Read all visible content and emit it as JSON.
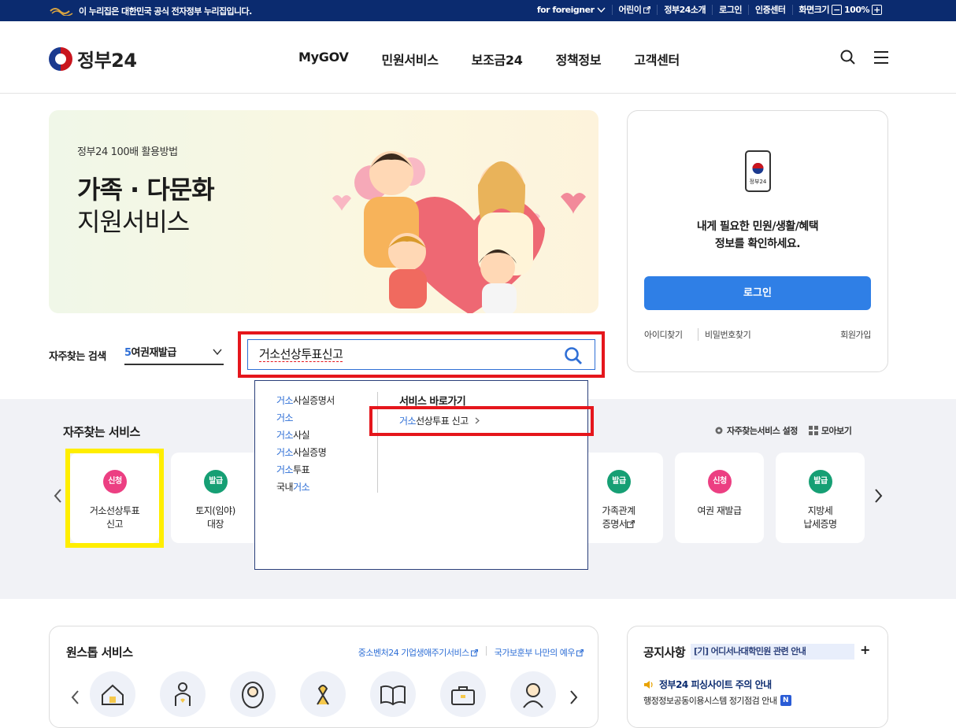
{
  "topbar": {
    "gov_notice": "이 누리집은 대한민국 공식 전자정부 누리집입니다.",
    "for_foreigner": "for foreigner",
    "kids": "어린이",
    "about": "정부24소개",
    "login": "로그인",
    "cert": "인증센터",
    "screen_size": "화면크기",
    "zoom": "100%"
  },
  "header": {
    "logo": "정부24",
    "menu": [
      "MyGOV",
      "민원서비스",
      "보조금24",
      "정책정보",
      "고객센터"
    ]
  },
  "banner": {
    "sub": "정부24 100배 활용방법",
    "title_bold": "가족 · 다문화",
    "title_regular": "지원서비스"
  },
  "login_card": {
    "phone_label": "정부24",
    "msg1": "내게 필요한 민원/생활/혜택",
    "msg2": "정보를 확인하세요.",
    "login_button": "로그인",
    "find_id": "아이디찾기",
    "find_pw": "비밀번호찾기",
    "join": "회원가입"
  },
  "search": {
    "freq_label": "자주찾는 검색",
    "freq_num": "5",
    "freq_text": "여권재발급",
    "query": "거소선상투표신고"
  },
  "suggest": {
    "items": [
      {
        "hl": "거소",
        "rest": "사실증명서",
        "pre": ""
      },
      {
        "hl": "거소",
        "rest": "",
        "pre": ""
      },
      {
        "hl": "거소",
        "rest": "사실",
        "pre": ""
      },
      {
        "hl": "거소",
        "rest": "사실증명",
        "pre": ""
      },
      {
        "hl": "거소",
        "rest": "투표",
        "pre": ""
      },
      {
        "hl": "거소",
        "rest": "",
        "pre": "국내"
      }
    ],
    "shortcut_title": "서비스 바로가기",
    "shortcut_hl": "거소",
    "shortcut_rest": "선상투표 신고"
  },
  "frequent": {
    "title": "자주찾는 서비스",
    "settings": "자주찾는서비스 설정",
    "view_all": "모아보기",
    "cards": [
      {
        "badge": "신청",
        "label": "거소선상투표\n신고"
      },
      {
        "badge": "발급",
        "label": "토지(임야)\n대장"
      },
      {
        "badge": "발급",
        "label": "가족관계\n증명서"
      },
      {
        "badge": "신청",
        "label": "여권 재발급"
      },
      {
        "badge": "발급",
        "label": "지방세\n납세증명"
      }
    ]
  },
  "onestop": {
    "title": "원스톱 서비스",
    "link1": "중소벤처24 기업생애주기서비스",
    "link2": "국가보훈부 나만의 예우"
  },
  "notice": {
    "title": "공지사항",
    "ticker": "[기] 어디서나대학민원 관련 안내",
    "alert": "정부24 피싱사이트 주의 안내",
    "line2": "행정정보공동이용시스템 정기점검 안내",
    "new_badge": "N"
  },
  "colors": {
    "topbar": "#0b2b6f",
    "accent": "#2f7fe6",
    "apply_badge": "#ec3f82",
    "issue_badge": "#169f74",
    "highlight_red": "#e5161c",
    "highlight_yellow": "#ffee00"
  }
}
